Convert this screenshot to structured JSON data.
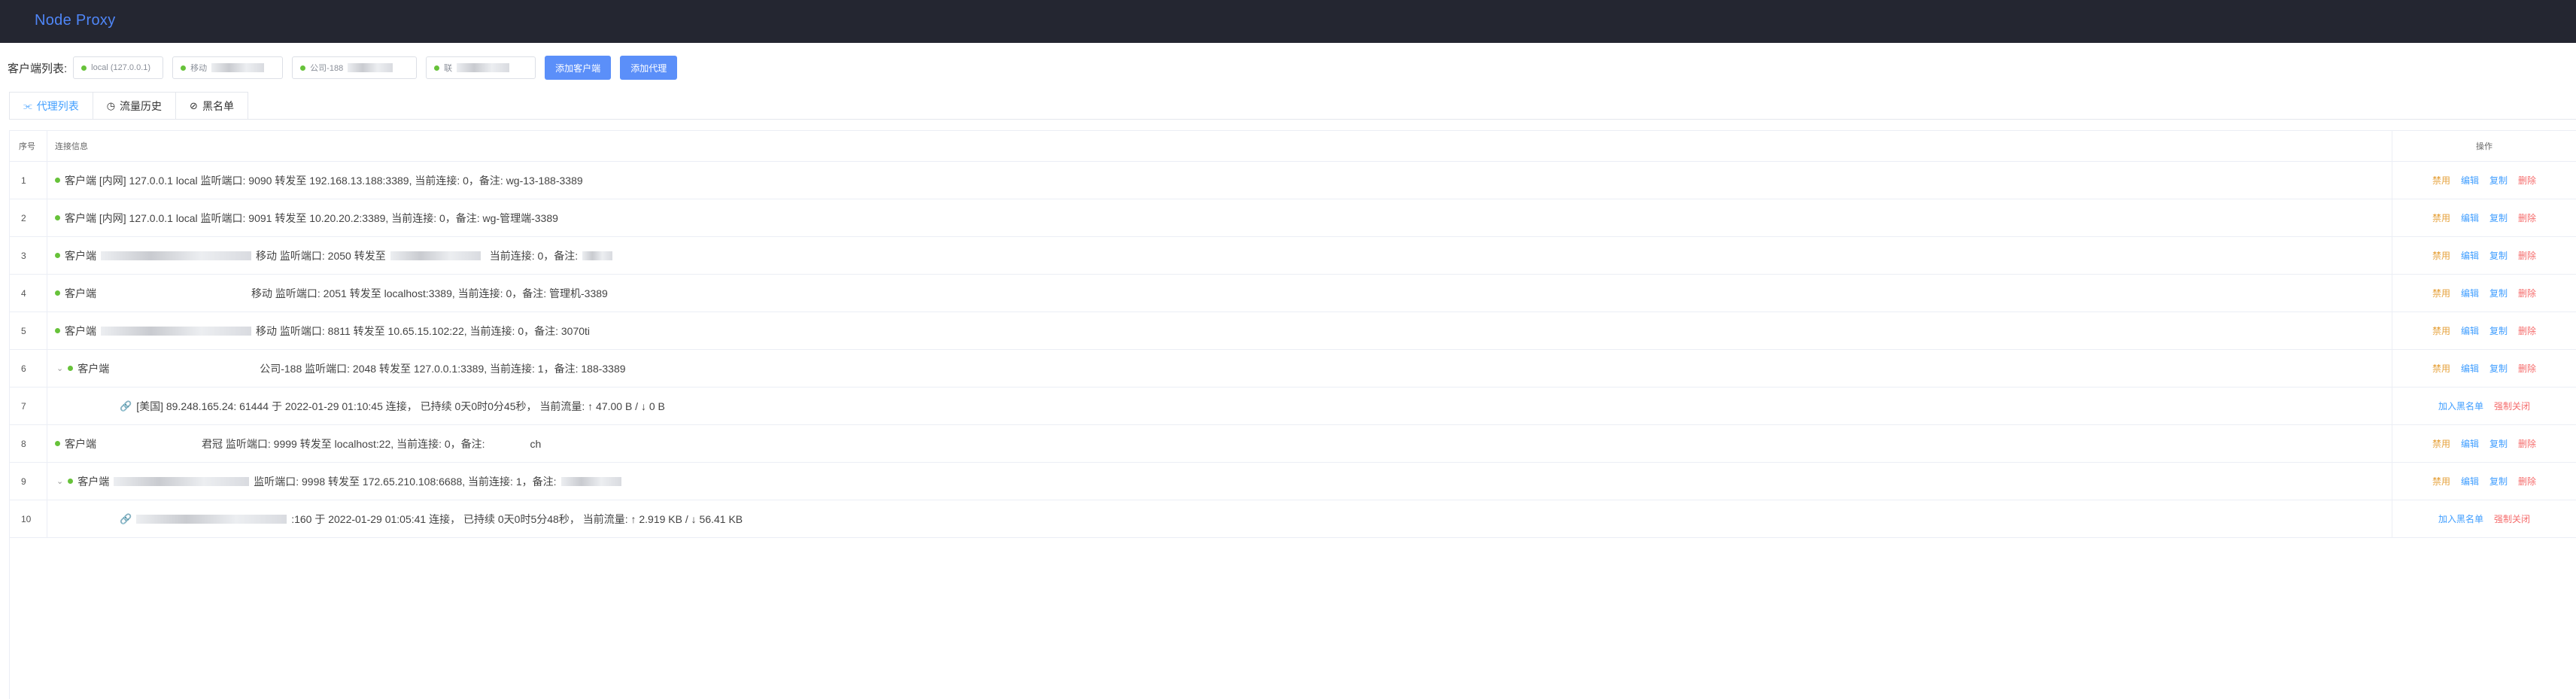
{
  "app": {
    "title": "Node Proxy"
  },
  "clients": {
    "label": "客户端列表:",
    "chips": [
      {
        "label": "local (127.0.0.1)",
        "status": "online"
      },
      {
        "label": "移动",
        "status": "online"
      },
      {
        "label": "公司-188",
        "status": "online"
      },
      {
        "label": "联",
        "status": "online"
      }
    ],
    "add_client_label": "添加客户端",
    "add_proxy_label": "添加代理"
  },
  "tabs": [
    {
      "label": "代理列表",
      "icon": "proxy-list-icon",
      "active": true
    },
    {
      "label": "流量历史",
      "icon": "history-icon",
      "active": false
    },
    {
      "label": "黑名单",
      "icon": "blacklist-icon",
      "active": false
    }
  ],
  "table": {
    "headers": {
      "no": "序号",
      "info": "连接信息",
      "ops": "操作"
    },
    "ops": {
      "disable": "禁用",
      "edit": "编辑",
      "copy": "复制",
      "delete": "删除",
      "blacklist": "加入黑名单",
      "force_close": "强制关闭"
    },
    "rows": [
      {
        "no": "1",
        "info": "客户端 [内网] 127.0.0.1 local 监听端口: 9090 转发至 192.168.13.188:3389,  当前连接: 0，备注: wg-13-188-3389"
      },
      {
        "no": "2",
        "info": "客户端 [内网] 127.0.0.1 local 监听端口: 9091 转发至 10.20.20.2:3389,  当前连接: 0，备注: wg-管理端-3389"
      },
      {
        "no": "3",
        "info_prefix": "客户端",
        "info_mid": "移动 监听端口: 2050 转发至",
        "info_suffix": "当前连接: 0，备注:"
      },
      {
        "no": "4",
        "info_prefix": "客户端",
        "info_mid": "移动 监听端口: 2051 转发至 localhost:3389,  当前连接: 0，备注: 管理机-3389"
      },
      {
        "no": "5",
        "info_prefix": "客户端",
        "info_mid": "移动 监听端口: 8811 转发至 10.65.15.102:22,  当前连接: 0，备注: 3070ti"
      },
      {
        "no": "6",
        "info_prefix": "客户端",
        "info_mid": "公司-188 监听端口: 2048 转发至 127.0.0.1:3389,  当前连接: 1，备注: 188-3389"
      },
      {
        "no": "7",
        "info": "[美国] 89.248.165.24: 61444 于 2022-01-29 01:10:45 连接，  已持续 0天0时0分45秒，  当前流量: ↑ 47.00 B / ↓ 0 B"
      },
      {
        "no": "8",
        "info_prefix": "客户端",
        "info_mid": "君冠 监听端口: 9999 转发至 localhost:22,  当前连接: 0，备注:",
        "info_suffix": "ch"
      },
      {
        "no": "9",
        "info_prefix": "客户端",
        "info_mid": "监听端口: 9998 转发至 172.65.210.108:6688,  当前连接: 1，备注:"
      },
      {
        "no": "10",
        "info_mid": ":160 于 2022-01-29 01:05:41 连接，  已持续 0天0时5分48秒，  当前流量: ↑ 2.919 KB / ↓ 56.41 KB"
      }
    ]
  },
  "colors": {
    "topbar": "#242631",
    "brand": "#4f86f7",
    "primary": "#5b8ff9",
    "online": "#67c23a",
    "warning": "#e6a23c",
    "danger": "#f56c6c",
    "link": "#409eff"
  }
}
